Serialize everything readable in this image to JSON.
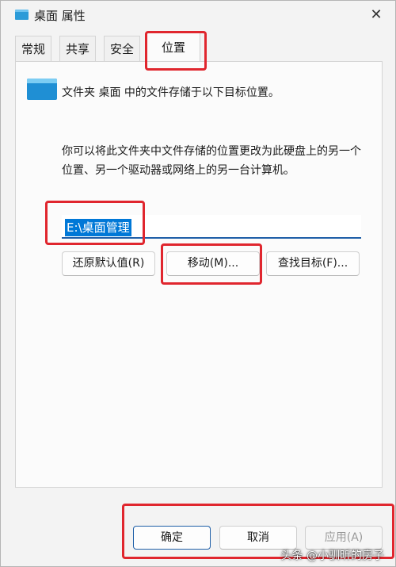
{
  "window": {
    "title": "桌面 属性",
    "close_glyph": "✕"
  },
  "tabs": [
    {
      "label": "常规",
      "active": false
    },
    {
      "label": "共享",
      "active": false
    },
    {
      "label": "安全",
      "active": false
    },
    {
      "label": "位置",
      "active": true
    }
  ],
  "location": {
    "description": "文件夹 桌面 中的文件存储于以下目标位置。",
    "hint": "你可以将此文件夹中文件存储的位置更改为此硬盘上的另一个位置、另一个驱动器或网络上的另一台计算机。",
    "path_value": "E:\\桌面管理"
  },
  "buttons": {
    "restore_default": "还原默认值(R)",
    "move": "移动(M)...",
    "find_target": "查找目标(F)..."
  },
  "footer": {
    "ok": "确定",
    "cancel": "取消",
    "apply": "应用(A)"
  },
  "watermark": "头条 @小驯昕的房子",
  "colors": {
    "highlight": "#e0262e",
    "selection": "#0078d7",
    "focus_border": "#1f5fa8"
  }
}
